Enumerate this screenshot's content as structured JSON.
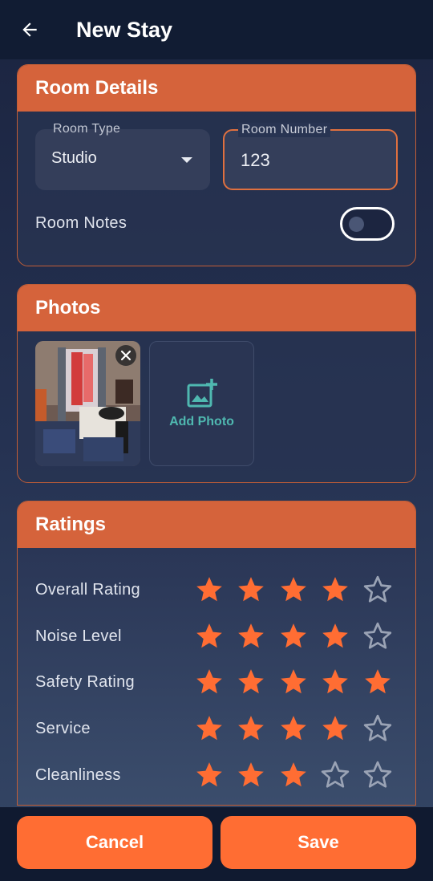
{
  "appbar": {
    "title": "New Stay",
    "back_icon": "arrow-left-icon"
  },
  "room_details": {
    "header": "Room Details",
    "room_type": {
      "label": "Room Type",
      "value": "Studio"
    },
    "room_number": {
      "label": "Room Number",
      "value": "123"
    },
    "room_notes": {
      "label": "Room Notes",
      "enabled": false
    }
  },
  "photos": {
    "header": "Photos",
    "items": [
      {
        "alt": "hotel room photo"
      }
    ],
    "add_label": "Add Photo"
  },
  "ratings": {
    "header": "Ratings",
    "items": [
      {
        "label": "Overall Rating",
        "value": 4,
        "max": 5
      },
      {
        "label": "Noise Level",
        "value": 4,
        "max": 5
      },
      {
        "label": "Safety Rating",
        "value": 5,
        "max": 5
      },
      {
        "label": "Service",
        "value": 4,
        "max": 5
      },
      {
        "label": "Cleanliness",
        "value": 3,
        "max": 5
      }
    ]
  },
  "actions": {
    "cancel": "Cancel",
    "save": "Save"
  },
  "colors": {
    "accent": "#ff6d33",
    "header": "#d5633b",
    "star_filled": "#ff6d33",
    "star_empty": "#9aa3b5",
    "teal": "#4fb8b0"
  }
}
